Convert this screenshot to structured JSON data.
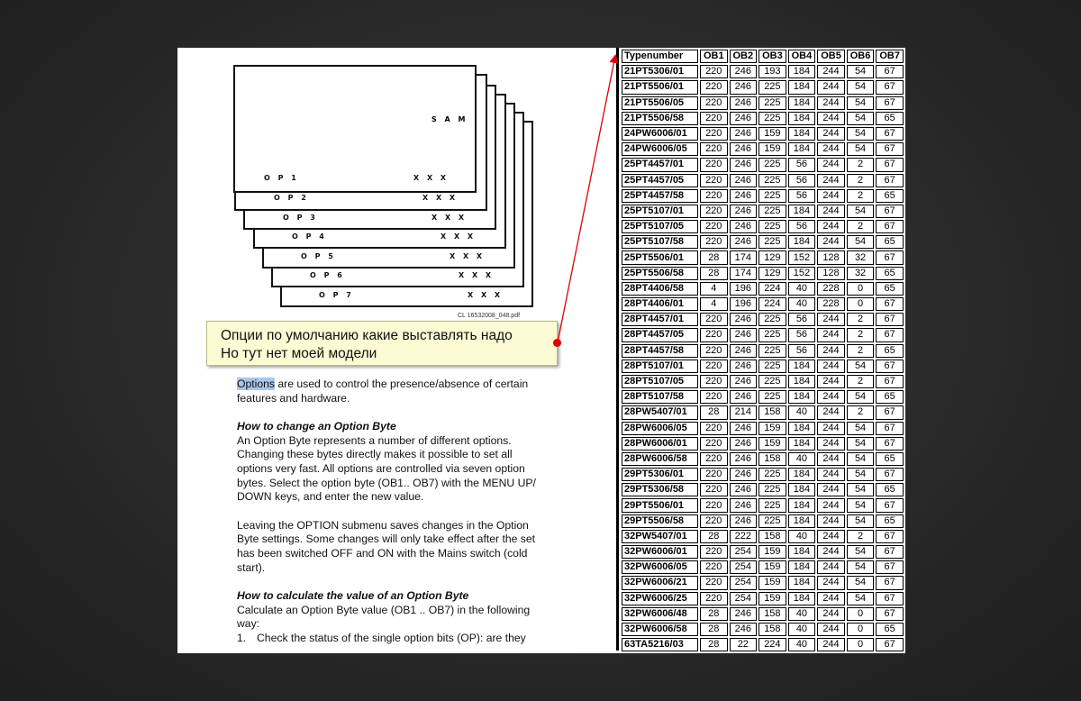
{
  "diagram": {
    "sam_label": "S A M",
    "rows": [
      {
        "op": "O P 1",
        "x": "X X X"
      },
      {
        "op": "O P 2",
        "x": "X X X"
      },
      {
        "op": "O P 3",
        "x": "X X X"
      },
      {
        "op": "O P 4",
        "x": "X X X"
      },
      {
        "op": "O P 5",
        "x": "X X X"
      },
      {
        "op": "O P 6",
        "x": "X X X"
      },
      {
        "op": "O P 7",
        "x": "X X X"
      }
    ],
    "caption": "CL 16532008_048.pdf"
  },
  "note": {
    "line1": "Опции по умолчанию какие выставлять надо",
    "line2": "Но тут нет моей модели",
    "marker_color": "#e00000"
  },
  "body": {
    "p1_highlight": "Options",
    "p1_rest": " are used to control the presence/absence of certain features and hardware.",
    "h1": "How to change an Option Byte",
    "p2": "An Option Byte represents a number of different options. Changing these bytes directly makes it possible to set all options very fast. All options are controlled via seven option bytes. Select the option byte (OB1.. OB7) with the MENU UP/ DOWN keys, and enter the new value.",
    "p3": "Leaving the OPTION submenu saves changes in the Option Byte settings. Some changes will only take effect after the set has been switched OFF and ON with the Mains switch (cold start).",
    "h2": "How to calculate the value of an Option Byte",
    "p4": "Calculate an Option Byte value (OB1 .. OB7) in the following way:",
    "li1_num": "1.",
    "li1": "Check the status of the single option bits (OP): are they"
  },
  "table": {
    "headers": [
      "Typenumber",
      "OB1",
      "OB2",
      "OB3",
      "OB4",
      "OB5",
      "OB6",
      "OB7"
    ],
    "rows": [
      [
        "21PT5306/01",
        "220",
        "246",
        "193",
        "184",
        "244",
        "54",
        "67"
      ],
      [
        "21PT5506/01",
        "220",
        "246",
        "225",
        "184",
        "244",
        "54",
        "67"
      ],
      [
        "21PT5506/05",
        "220",
        "246",
        "225",
        "184",
        "244",
        "54",
        "67"
      ],
      [
        "21PT5506/58",
        "220",
        "246",
        "225",
        "184",
        "244",
        "54",
        "65"
      ],
      [
        "24PW6006/01",
        "220",
        "246",
        "159",
        "184",
        "244",
        "54",
        "67"
      ],
      [
        "24PW6006/05",
        "220",
        "246",
        "159",
        "184",
        "244",
        "54",
        "67"
      ],
      [
        "25PT4457/01",
        "220",
        "246",
        "225",
        "56",
        "244",
        "2",
        "67"
      ],
      [
        "25PT4457/05",
        "220",
        "246",
        "225",
        "56",
        "244",
        "2",
        "67"
      ],
      [
        "25PT4457/58",
        "220",
        "246",
        "225",
        "56",
        "244",
        "2",
        "65"
      ],
      [
        "25PT5107/01",
        "220",
        "246",
        "225",
        "184",
        "244",
        "54",
        "67"
      ],
      [
        "25PT5107/05",
        "220",
        "246",
        "225",
        "56",
        "244",
        "2",
        "67"
      ],
      [
        "25PT5107/58",
        "220",
        "246",
        "225",
        "184",
        "244",
        "54",
        "65"
      ],
      [
        "25PT5506/01",
        "28",
        "174",
        "129",
        "152",
        "128",
        "32",
        "67"
      ],
      [
        "25PT5506/58",
        "28",
        "174",
        "129",
        "152",
        "128",
        "32",
        "65"
      ],
      [
        "28PT4406/58",
        "4",
        "196",
        "224",
        "40",
        "228",
        "0",
        "65"
      ],
      [
        "28PT4406/01",
        "4",
        "196",
        "224",
        "40",
        "228",
        "0",
        "67"
      ],
      [
        "28PT4457/01",
        "220",
        "246",
        "225",
        "56",
        "244",
        "2",
        "67"
      ],
      [
        "28PT4457/05",
        "220",
        "246",
        "225",
        "56",
        "244",
        "2",
        "67"
      ],
      [
        "28PT4457/58",
        "220",
        "246",
        "225",
        "56",
        "244",
        "2",
        "65"
      ],
      [
        "28PT5107/01",
        "220",
        "246",
        "225",
        "184",
        "244",
        "54",
        "67"
      ],
      [
        "28PT5107/05",
        "220",
        "246",
        "225",
        "184",
        "244",
        "2",
        "67"
      ],
      [
        "28PT5107/58",
        "220",
        "246",
        "225",
        "184",
        "244",
        "54",
        "65"
      ],
      [
        "28PW5407/01",
        "28",
        "214",
        "158",
        "40",
        "244",
        "2",
        "67"
      ],
      [
        "28PW6006/05",
        "220",
        "246",
        "159",
        "184",
        "244",
        "54",
        "67"
      ],
      [
        "28PW6006/01",
        "220",
        "246",
        "159",
        "184",
        "244",
        "54",
        "67"
      ],
      [
        "28PW6006/58",
        "220",
        "246",
        "158",
        "40",
        "244",
        "54",
        "65"
      ],
      [
        "29PT5306/01",
        "220",
        "246",
        "225",
        "184",
        "244",
        "54",
        "67"
      ],
      [
        "29PT5306/58",
        "220",
        "246",
        "225",
        "184",
        "244",
        "54",
        "65"
      ],
      [
        "29PT5506/01",
        "220",
        "246",
        "225",
        "184",
        "244",
        "54",
        "67"
      ],
      [
        "29PT5506/58",
        "220",
        "246",
        "225",
        "184",
        "244",
        "54",
        "65"
      ],
      [
        "32PW5407/01",
        "28",
        "222",
        "158",
        "40",
        "244",
        "2",
        "67"
      ],
      [
        "32PW6006/01",
        "220",
        "254",
        "159",
        "184",
        "244",
        "54",
        "67"
      ],
      [
        "32PW6006/05",
        "220",
        "254",
        "159",
        "184",
        "244",
        "54",
        "67"
      ],
      [
        "32PW6006/21",
        "220",
        "254",
        "159",
        "184",
        "244",
        "54",
        "67"
      ],
      [
        "32PW6006/25",
        "220",
        "254",
        "159",
        "184",
        "244",
        "54",
        "67"
      ],
      [
        "32PW6006/48",
        "28",
        "246",
        "158",
        "40",
        "244",
        "0",
        "67"
      ],
      [
        "32PW6006/58",
        "28",
        "246",
        "158",
        "40",
        "244",
        "0",
        "65"
      ],
      [
        "63TA5216/03",
        "28",
        "22",
        "224",
        "40",
        "244",
        "0",
        "67"
      ]
    ]
  }
}
